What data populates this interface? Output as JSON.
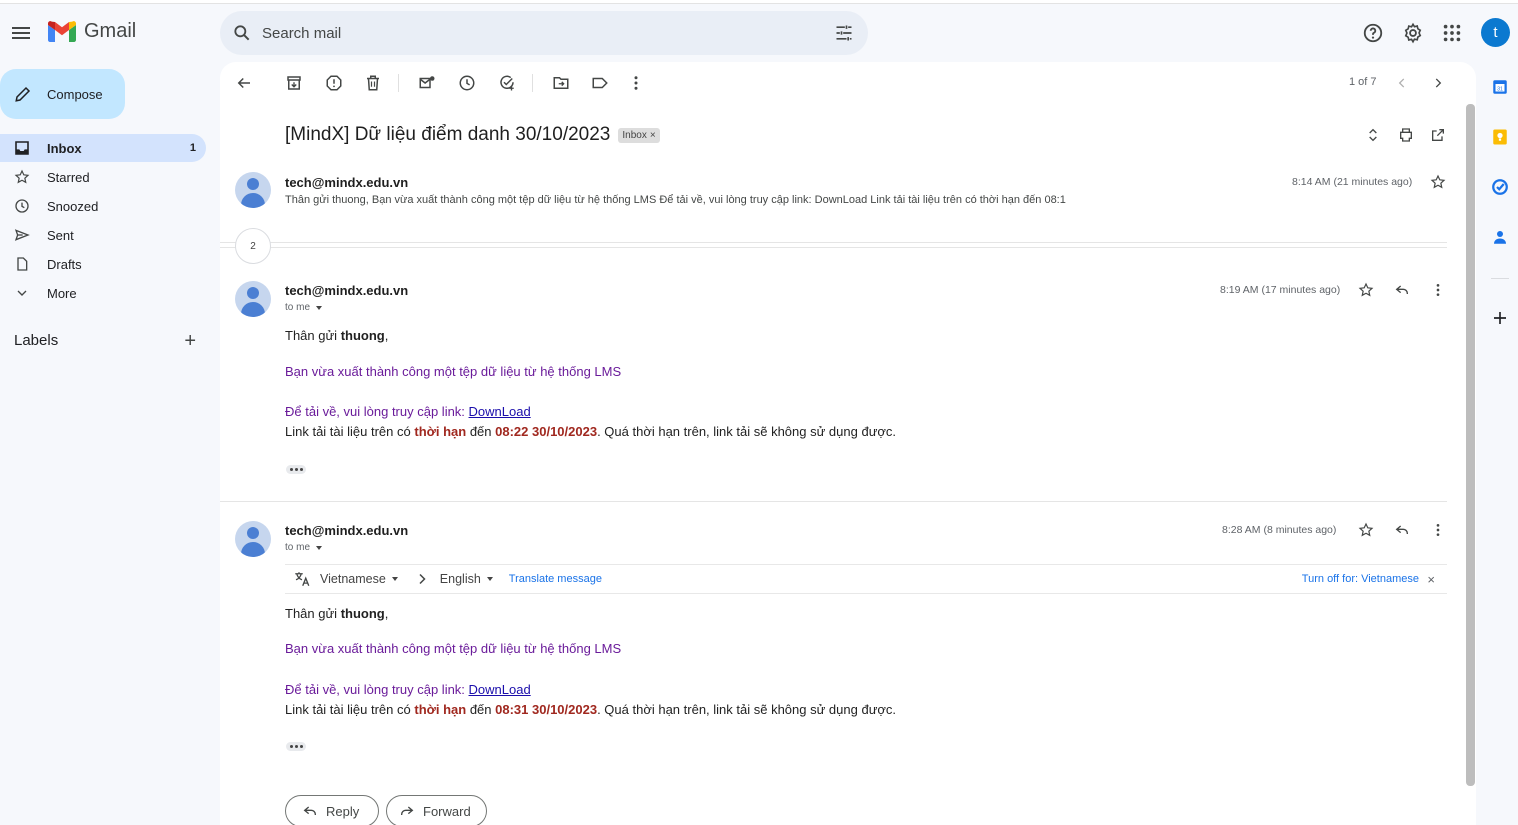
{
  "app": {
    "name": "Gmail",
    "brand_color": "#1a73e8",
    "avatar_letter": "t"
  },
  "search": {
    "placeholder": "Search mail"
  },
  "compose": {
    "label": "Compose"
  },
  "nav": [
    {
      "label": "Inbox",
      "count": "1",
      "icon": "inbox-icon",
      "active": true
    },
    {
      "label": "Starred",
      "icon": "star-icon"
    },
    {
      "label": "Snoozed",
      "icon": "clock-icon"
    },
    {
      "label": "Sent",
      "icon": "send-icon"
    },
    {
      "label": "Drafts",
      "icon": "draft-icon"
    },
    {
      "label": "More",
      "icon": "chevron-down-icon"
    }
  ],
  "labels": {
    "title": "Labels"
  },
  "toolbar": {
    "pager": "1 of 7"
  },
  "thread": {
    "subject": "[MindX] Dữ liệu điểm danh 30/10/2023",
    "badge": "Inbox",
    "collapsed_count": "2"
  },
  "messages": [
    {
      "sender": "tech@mindx.edu.vn",
      "time": "8:14 AM (21 minutes ago)",
      "snippet": "Thân gửi thuong, Bạn vừa xuất thành công một tệp dữ liệu từ hệ thống LMS Để tải về, vui lòng truy cập link: DownLoad Link tải tài liệu trên có thời hạn đến 08:1"
    },
    {
      "sender": "tech@mindx.edu.vn",
      "to": "to me",
      "time": "8:19 AM (17 minutes ago)",
      "greeting": "Thân gửi ",
      "name": "thuong",
      "greeting_end": ",",
      "line1": "Bạn vừa xuất thành công một tệp dữ liệu từ hệ thống LMS",
      "line2_pre": "Để tải về, vui lòng truy cập link: ",
      "link": "DownLoad",
      "line3_pre": "Link tải tài liệu trên có ",
      "line3_bold": "thời hạn",
      "line3_mid": " đến ",
      "line3_date": "08:22 30/10/2023",
      "line3_post": ". Quá thời hạn trên, link tải sẽ không sử dụng được."
    },
    {
      "sender": "tech@mindx.edu.vn",
      "to": "to me",
      "time": "8:28 AM (8 minutes ago)",
      "greeting": "Thân gửi ",
      "name": "thuong",
      "greeting_end": ",",
      "line1": "Bạn vừa xuất thành công một tệp dữ liệu từ hệ thống LMS",
      "line2_pre": "Để tải về, vui lòng truy cập link: ",
      "link": "DownLoad",
      "line3_pre": "Link tải tài liệu trên có ",
      "line3_bold": "thời hạn",
      "line3_mid": " đến ",
      "line3_date": "08:31 30/10/2023",
      "line3_post": ". Quá thời hạn trên, link tải sẽ không sử dụng được."
    }
  ],
  "translate": {
    "from": "Vietnamese",
    "to": "English",
    "action": "Translate message",
    "turn_off": "Turn off for: Vietnamese"
  },
  "actions": {
    "reply": "Reply",
    "forward": "Forward"
  }
}
